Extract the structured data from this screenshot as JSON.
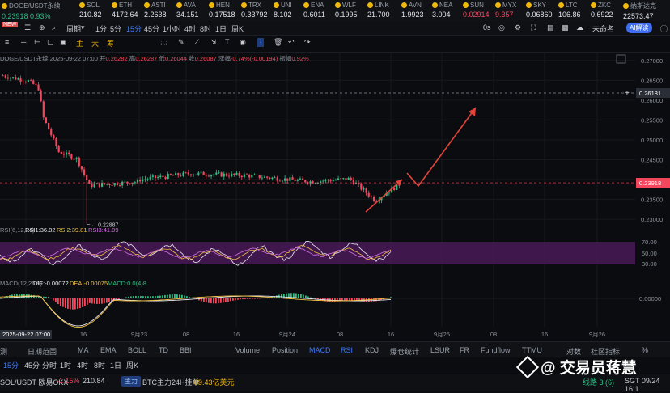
{
  "ticker": [
    {
      "name": "DOGE/USDT永续",
      "price": "0.23918  0.93%",
      "cls": "up",
      "x": 2
    },
    {
      "name": "SOL",
      "price": "210.82",
      "cls": "",
      "x": 98
    },
    {
      "name": "ETH",
      "price": "4172.64",
      "cls": "",
      "x": 138
    },
    {
      "name": "ASTI",
      "price": "2.2638",
      "cls": "",
      "x": 178
    },
    {
      "name": "AVA",
      "price": "34.151",
      "cls": "",
      "x": 218
    },
    {
      "name": "HEN",
      "price": "0.17518",
      "cls": "",
      "x": 258
    },
    {
      "name": "TRX",
      "price": "0.33792",
      "cls": "",
      "x": 298
    },
    {
      "name": "UNI",
      "price": "8.102",
      "cls": "",
      "x": 338
    },
    {
      "name": "ENA",
      "price": "0.6011",
      "cls": "",
      "x": 375
    },
    {
      "name": "WLF",
      "price": "0.1995",
      "cls": "",
      "x": 414
    },
    {
      "name": "LINK",
      "price": "21.700",
      "cls": "",
      "x": 454
    },
    {
      "name": "AVN",
      "price": "1.9923",
      "cls": "",
      "x": 496
    },
    {
      "name": "NEA",
      "price": "3.004",
      "cls": "",
      "x": 534
    },
    {
      "name": "SUN",
      "price": "0.02914",
      "cls": "dn",
      "x": 572
    },
    {
      "name": "MYX",
      "price": "9.357",
      "cls": "dn",
      "x": 612
    },
    {
      "name": "SKY",
      "price": "0.06860",
      "cls": "",
      "x": 650
    },
    {
      "name": "LTC",
      "price": "106.86",
      "cls": "",
      "x": 690
    },
    {
      "name": "ZKC",
      "price": "0.6922",
      "cls": "",
      "x": 730
    },
    {
      "name": "纳斯达克",
      "price": "22573.47",
      "cls": "",
      "x": 770
    }
  ],
  "toolbar": {
    "new_badge": "NEW",
    "period_label": "周期",
    "intervals": [
      "1分",
      "5分",
      "15分",
      "45分",
      "1小时",
      "4时",
      "8时",
      "1日",
      "周K"
    ],
    "active_interval": "15分",
    "right_items": [
      "0s",
      "未命名"
    ],
    "ai_label": "AI解读",
    "indicator_labels": [
      "主",
      "大",
      "筹"
    ]
  },
  "info": {
    "symbol": "DOGE/USDT永续",
    "time": "2025-09-22 07:00",
    "open_label": "开",
    "open": "0.26282",
    "high_label": "高",
    "high": "0.26287",
    "low_label": "低",
    "low": "0.26044",
    "close_label": "收",
    "close": "0.26087",
    "change_label": "涨幅",
    "change": "-0.74%(-0.00194)",
    "amp_label": "振幅",
    "amp": "0.92%"
  },
  "chart_data": {
    "type": "candlestick",
    "price_axis": [
      "0.27000",
      "0.26500",
      "0.26000",
      "0.25500",
      "0.25000",
      "0.24500",
      "0.24000",
      "0.23500",
      "0.23000"
    ],
    "ylim": [
      0.229,
      0.2722
    ],
    "low_marker": "0.22887",
    "crosshair_price": "0.26181",
    "last_price": "0.23918",
    "rsi": {
      "label": "RSI(6,12,24)",
      "rsi1": "RSI1:36.82",
      "rsi2": "RSI2:39.81",
      "rsi3": "RSI3:41.09",
      "levels": [
        "70.00",
        "50.00",
        "30.00"
      ]
    },
    "macd": {
      "label": "MACD(12,26,9)",
      "dif": "DIF:-0.00072",
      "dea": "DEA:-0.00075",
      "macd": "MACD:0.0(4)8",
      "zero": "0.00000"
    },
    "time_axis": [
      "2025-09-22 07:00",
      "16",
      "9月23",
      "08",
      "16",
      "9月24",
      "08",
      "16",
      "9月25",
      "08",
      "16",
      "9月26"
    ]
  },
  "indicator_bar": {
    "left": [
      "测",
      "日期范围"
    ],
    "main": [
      "MA",
      "EMA",
      "BOLL",
      "TD",
      "BBI"
    ],
    "sub": [
      "Volume",
      "Position",
      "MACD",
      "RSI",
      "KDJ",
      "爆仓统计",
      "LSUR",
      "FR",
      "Fundflow",
      "TTMU"
    ],
    "active": [
      "MACD",
      "RSI"
    ],
    "right": [
      "对数",
      "社区指标",
      "%"
    ]
  },
  "bottom1": {
    "intervals": [
      "15分",
      "45分",
      "分时",
      "1时",
      "4时",
      "8时",
      "1日",
      "周K"
    ]
  },
  "bottom2": {
    "symbol": "SOL/USDT 欧易OKX",
    "change": "-1.15%",
    "price": "210.84",
    "badge": "主力",
    "note": "BTC主力24H挂单",
    "note_value": "89.43亿美元",
    "right": "线路 3 (6)",
    "right2": "SGT 09/24 16:1"
  },
  "watermark": "@ 交易员蒋慧",
  "colors": {
    "up": "#2ebd85",
    "down": "#f6465d",
    "accent": "#3d7bf7",
    "rsi_band": "#5a1f6b"
  }
}
